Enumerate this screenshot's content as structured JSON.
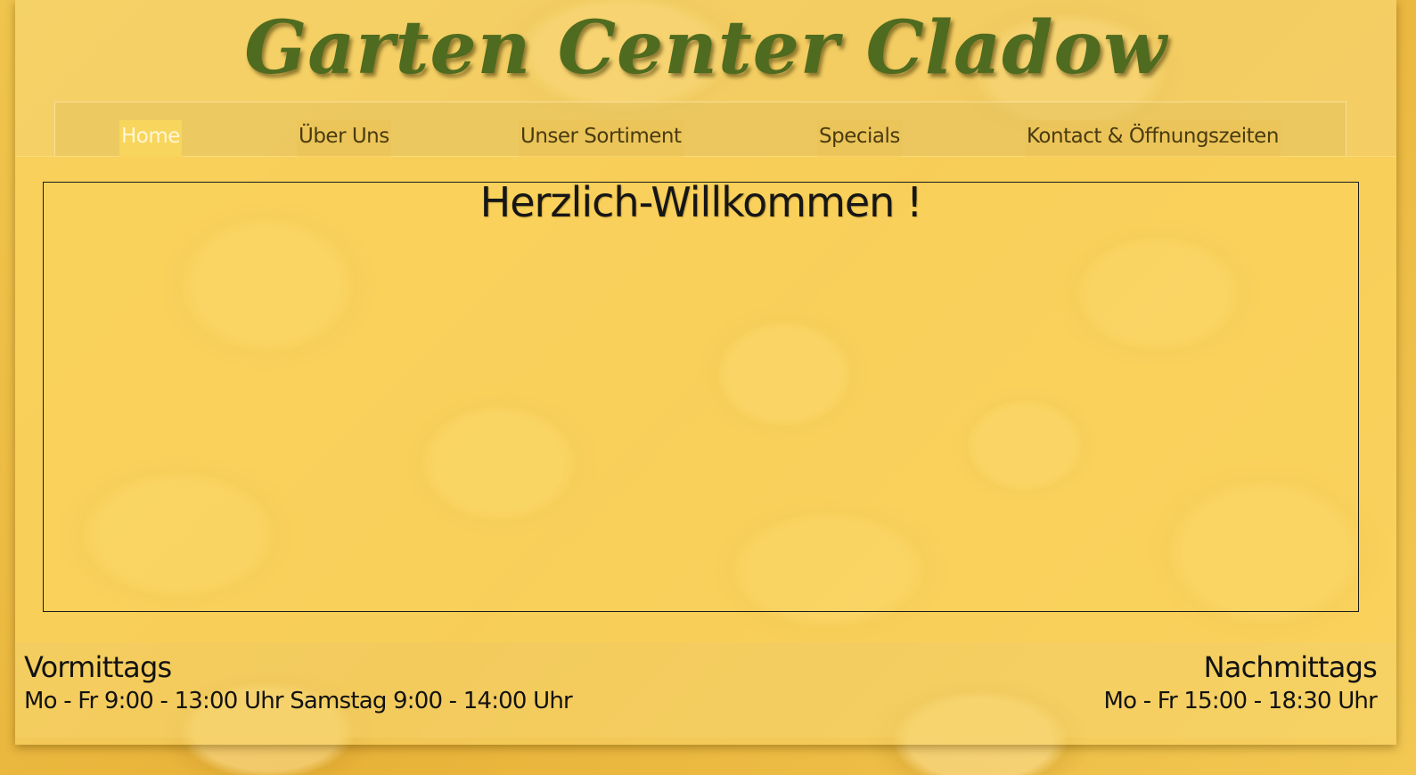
{
  "header": {
    "site_title": "Garten Center Cladow"
  },
  "nav": {
    "items": [
      {
        "label": "Home",
        "active": true
      },
      {
        "label": "Über Uns",
        "active": false
      },
      {
        "label": "Unser Sortiment",
        "active": false
      },
      {
        "label": "Specials",
        "active": false
      },
      {
        "label": "Kontact & Öffnungszeiten",
        "active": false
      }
    ]
  },
  "main": {
    "welcome_heading": "Herzlich-Willkommen !"
  },
  "footer": {
    "morning": {
      "title": "Vormittags",
      "text": "Mo - Fr 9:00 - 13:00 Uhr Samstag 9:00 - 14:00 Uhr"
    },
    "afternoon": {
      "title": "Nachmittags",
      "text": "Mo - Fr 15:00 - 18:30 Uhr"
    }
  },
  "colors": {
    "title_green": "#4f6b1f",
    "active_nav_bg": "#f8d65d",
    "page_yellow": "#fcd45a"
  },
  "background": {
    "icon": "yellow-petals-background"
  }
}
